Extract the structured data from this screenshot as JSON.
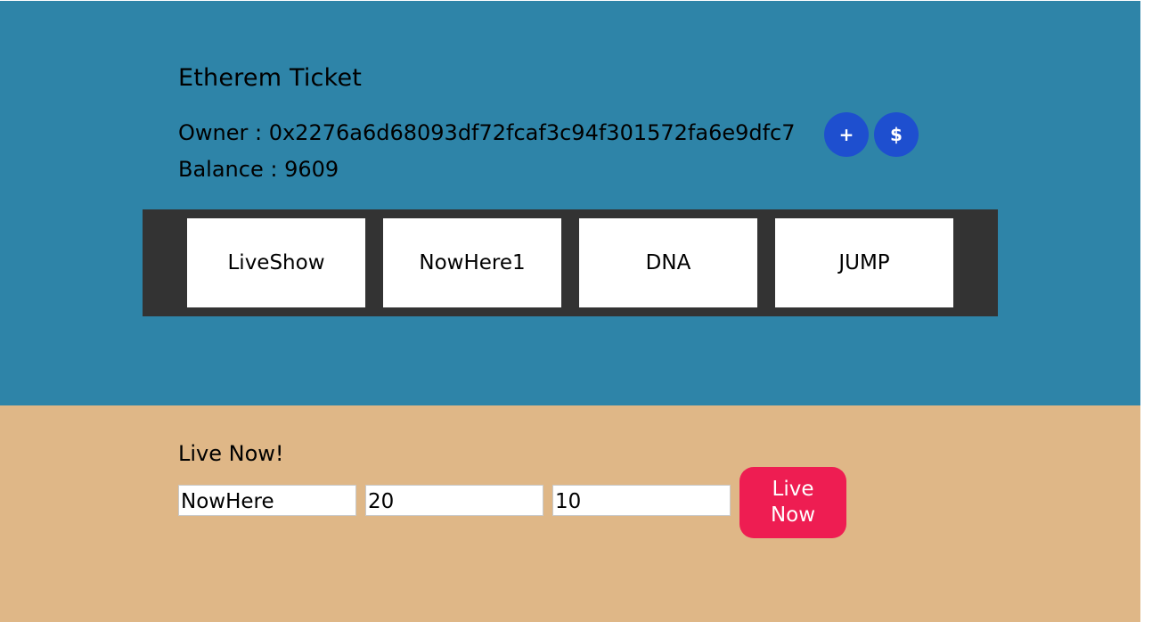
{
  "header": {
    "title": "Etherem Ticket",
    "owner_text": "Owner : 0x2276a6d68093df72fcaf3c94f301572fa6e9dfc7",
    "balance_text": "Balance : 9609",
    "add_button_label": "+",
    "dollar_button_label": "$"
  },
  "shows": [
    {
      "name": "LiveShow"
    },
    {
      "name": "NowHere1"
    },
    {
      "name": "DNA"
    },
    {
      "name": "JUMP"
    }
  ],
  "live": {
    "title": "Live Now!",
    "name_value": "NowHere",
    "price_value": "20",
    "count_value": "10",
    "button_label": "Live Now"
  },
  "colors": {
    "top_background": "#2e84a8",
    "bottom_background": "#dfb787",
    "show_bar_background": "#333333",
    "circle_button": "#1e4fcf",
    "live_button": "#ee1d52"
  }
}
